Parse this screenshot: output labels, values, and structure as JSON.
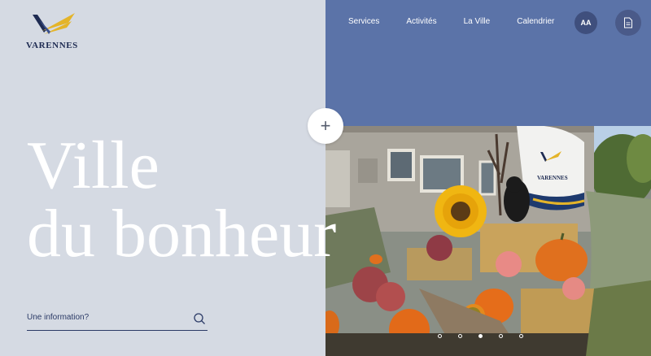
{
  "brand": {
    "name": "VARENNES",
    "colors": {
      "navy": "#1e2b52",
      "gold": "#e4b429",
      "blue_band": "#5b73a8",
      "background": "#d5dae3"
    }
  },
  "nav": {
    "items": [
      {
        "label": "Services"
      },
      {
        "label": "Activités"
      },
      {
        "label": "La Ville"
      },
      {
        "label": "Calendrier"
      }
    ],
    "text_size_label": "AA",
    "doc_icon": "document-icon"
  },
  "hero": {
    "line1": "Ville",
    "line2": "du bonheur"
  },
  "expand_button": {
    "icon": "plus-icon",
    "label": "+"
  },
  "search": {
    "placeholder": "Une information?",
    "icon": "search-icon"
  },
  "carousel": {
    "slide_count": 5,
    "active_index": 2
  }
}
